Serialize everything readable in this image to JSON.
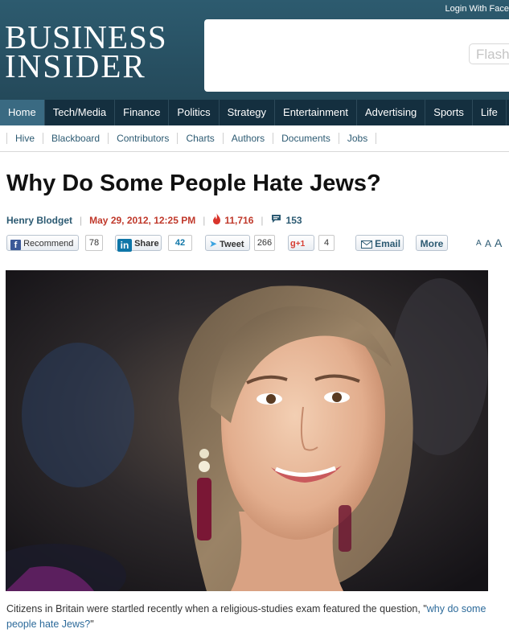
{
  "header": {
    "login_text": "Login With Face",
    "logo_line1": "BUSINESS",
    "logo_line2": "INSIDER",
    "ad_text": "Flash"
  },
  "main_nav": [
    "Home",
    "Tech/Media",
    "Finance",
    "Politics",
    "Strategy",
    "Entertainment",
    "Advertising",
    "Sports",
    "Life"
  ],
  "sub_nav": [
    "Hive",
    "Blackboard",
    "Contributors",
    "Charts",
    "Authors",
    "Documents",
    "Jobs"
  ],
  "article": {
    "title": "Why Do Some People Hate Jews?",
    "author": "Henry Blodget",
    "date": "May 29, 2012, 12:25 PM",
    "views": "11,716",
    "comments": "153",
    "caption_before": "Citizens in Britain were startled recently when a religious-studies exam featured the question, \"",
    "caption_link": "why do some people hate Jews?",
    "caption_after": "\""
  },
  "share": {
    "facebook_label": "Recommend",
    "facebook_count": "78",
    "linkedin_label": "Share",
    "linkedin_count": "42",
    "twitter_label": "Tweet",
    "twitter_count": "266",
    "gplus_label": "+1",
    "gplus_count": "4",
    "email_label": "Email",
    "more_label": "More",
    "font_small": "A",
    "font_medium": "A",
    "font_large": "A"
  },
  "colors": {
    "header_bg": "#2d5b6f",
    "nav_bg": "#142f3f",
    "nav_active": "#3a6a82",
    "link": "#2c5a72",
    "date": "#c0392b"
  }
}
